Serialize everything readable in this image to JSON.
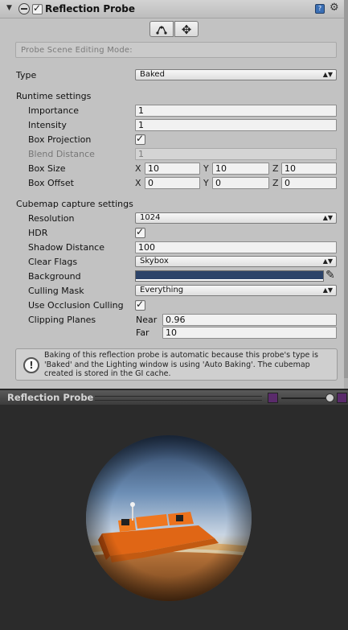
{
  "component": {
    "title": "Reflection Probe",
    "enabled": true
  },
  "edit_mode_label": "Probe Scene Editing Mode:",
  "type": {
    "label": "Type",
    "value": "Baked"
  },
  "runtime_settings": {
    "heading": "Runtime settings",
    "importance": {
      "label": "Importance",
      "value": "1"
    },
    "intensity": {
      "label": "Intensity",
      "value": "1"
    },
    "box_projection": {
      "label": "Box Projection",
      "checked": true
    },
    "blend_distance": {
      "label": "Blend Distance",
      "value": "1"
    },
    "box_size": {
      "label": "Box Size",
      "x": "10",
      "y": "10",
      "z": "10"
    },
    "box_offset": {
      "label": "Box Offset",
      "x": "0",
      "y": "0",
      "z": "0"
    },
    "axis_x": "X",
    "axis_y": "Y",
    "axis_z": "Z"
  },
  "cubemap_settings": {
    "heading": "Cubemap capture settings",
    "resolution": {
      "label": "Resolution",
      "value": "1024"
    },
    "hdr": {
      "label": "HDR",
      "checked": true
    },
    "shadow_distance": {
      "label": "Shadow Distance",
      "value": "100"
    },
    "clear_flags": {
      "label": "Clear Flags",
      "value": "Skybox"
    },
    "background": {
      "label": "Background",
      "color": "#2c4369"
    },
    "culling_mask": {
      "label": "Culling Mask",
      "value": "Everything"
    },
    "occlusion_culling": {
      "label": "Use Occlusion Culling",
      "checked": true
    },
    "clipping_planes": {
      "label": "Clipping Planes",
      "near_label": "Near",
      "near": "0.96",
      "far_label": "Far",
      "far": "10"
    }
  },
  "help_message": "Baking of this reflection probe is automatic because this probe's type is 'Baked' and the Lighting window is using 'Auto Baking'. The cubemap created is stored in the GI cache.",
  "preview": {
    "title": "Reflection Probe"
  }
}
